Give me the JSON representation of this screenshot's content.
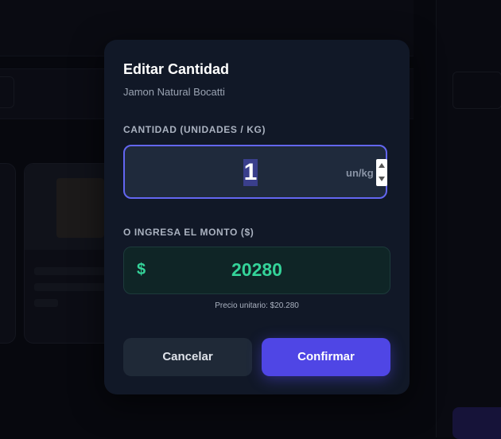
{
  "modal": {
    "title": "Editar Cantidad",
    "product_name": "Jamon Natural Bocatti",
    "quantity": {
      "label": "CANTIDAD (UNIDADES / KG)",
      "value": "1",
      "unit": "un/kg"
    },
    "amount": {
      "label": "O INGRESA EL MONTO ($)",
      "currency_symbol": "$",
      "value": "20280"
    },
    "unit_price": "Precio unitario: $20.280",
    "buttons": {
      "cancel": "Cancelar",
      "confirm": "Confirmar"
    }
  },
  "colors": {
    "accent": "#6366f1",
    "confirm": "#4f46e5",
    "money": "#34d399",
    "modal_bg": "#111827"
  }
}
